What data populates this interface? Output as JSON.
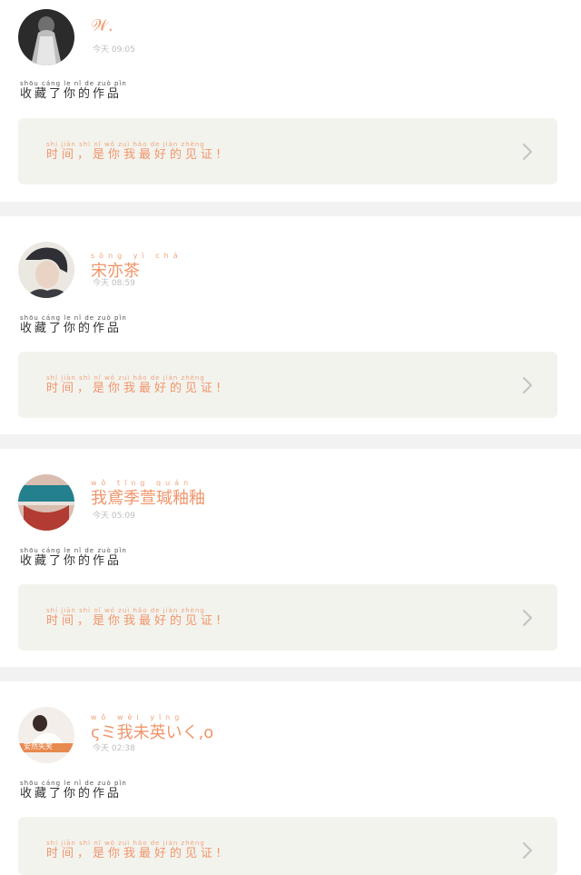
{
  "posts": [
    {
      "username": "𝒲.",
      "username_ruby": "",
      "time_label": "今天",
      "time": "09:05",
      "action_pinyin": "shōu cáng le nǐ de zuò pǐn",
      "action_text": "收藏了你的作品",
      "quote_pinyin": "shí jiān   shì nǐ wǒ zuì hǎo de jiàn zhèng",
      "quote_text": "时间，是你我最好的见证!",
      "avatar_colors": [
        "#2a2a2a",
        "#8a8a8a"
      ]
    },
    {
      "username": "宋亦茶",
      "username_ruby": "sòng yì chá",
      "time_label": "今天",
      "time": "08:59",
      "action_pinyin": "shōu cáng le nǐ de zuò pǐn",
      "action_text": "收藏了你的作品",
      "quote_pinyin": "shí jiān   shì nǐ wǒ zuì hǎo de jiàn zhèng",
      "quote_text": "时间，是你我最好的见证!",
      "avatar_colors": [
        "#e6e2d8",
        "#3a3a3a"
      ]
    },
    {
      "username": "我鳶季萱瑊釉釉",
      "username_ruby": "wǒ     tīng quán",
      "time_label": "今天",
      "time": "05:09",
      "action_pinyin": "shōu cáng le nǐ de zuò pǐn",
      "action_text": "收藏了你的作品",
      "quote_pinyin": "shí jiān   shì nǐ wǒ zuì hǎo de jiàn zhèng",
      "quote_text": "时间，是你我最好的见证!",
      "avatar_colors": [
        "#d8b9ae",
        "#1f7f8a"
      ]
    },
    {
      "username": "ςミ我未英いく,o",
      "username_ruby": "     wǒ wèi yīng",
      "time_label": "今天",
      "time": "02:38",
      "action_pinyin": "shōu cáng le nǐ de zuò pǐn",
      "action_text": "收藏了你的作品",
      "quote_pinyin": "shí jiān   shì nǐ wǒ zuì hǎo de jiàn zhèng",
      "quote_text": "时间，是你我最好的见证!",
      "avatar_colors": [
        "#f2ece6",
        "#e8894f"
      ],
      "avatar_caption": "安然失笑"
    }
  ]
}
